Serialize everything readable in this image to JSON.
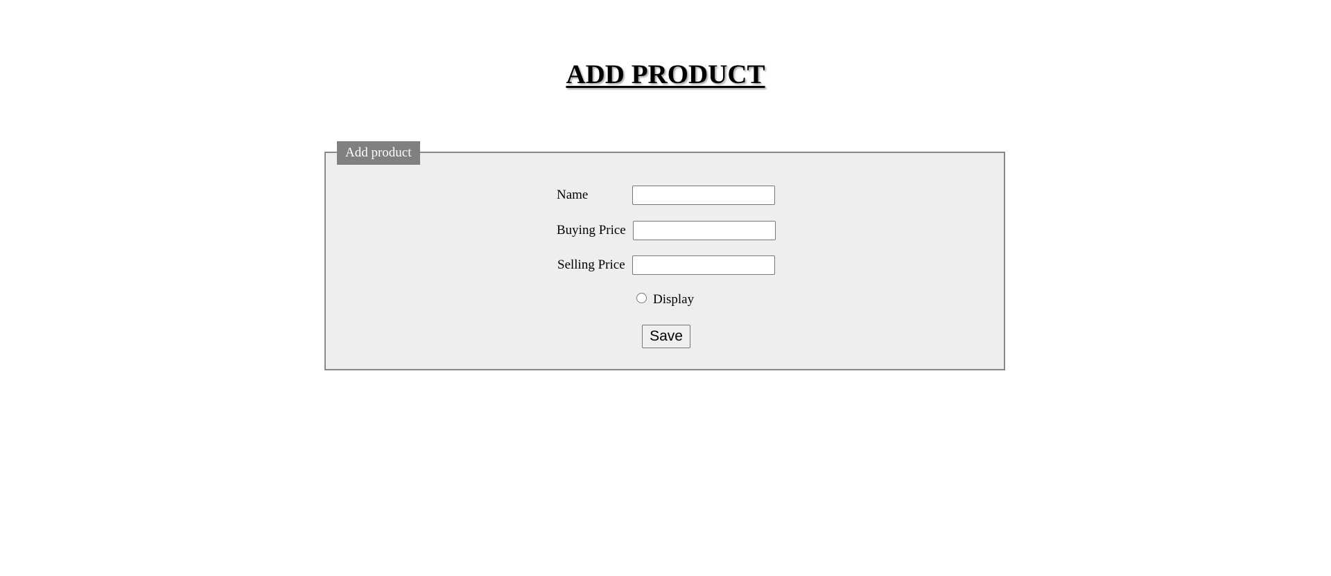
{
  "page": {
    "title": "ADD PRODUCT"
  },
  "form": {
    "legend": "Add product",
    "fields": [
      {
        "label": "Name",
        "value": "",
        "placeholder": ""
      },
      {
        "label": "Buying Price",
        "value": "",
        "placeholder": ""
      },
      {
        "label": "Selling Price",
        "value": "",
        "placeholder": ""
      }
    ],
    "display_option": {
      "label": "Display",
      "checked": false
    },
    "save_label": "Save"
  },
  "colors": {
    "legend_bg": "#808080",
    "fieldset_bg": "#eeeeee",
    "fieldset_border": "#888888"
  }
}
